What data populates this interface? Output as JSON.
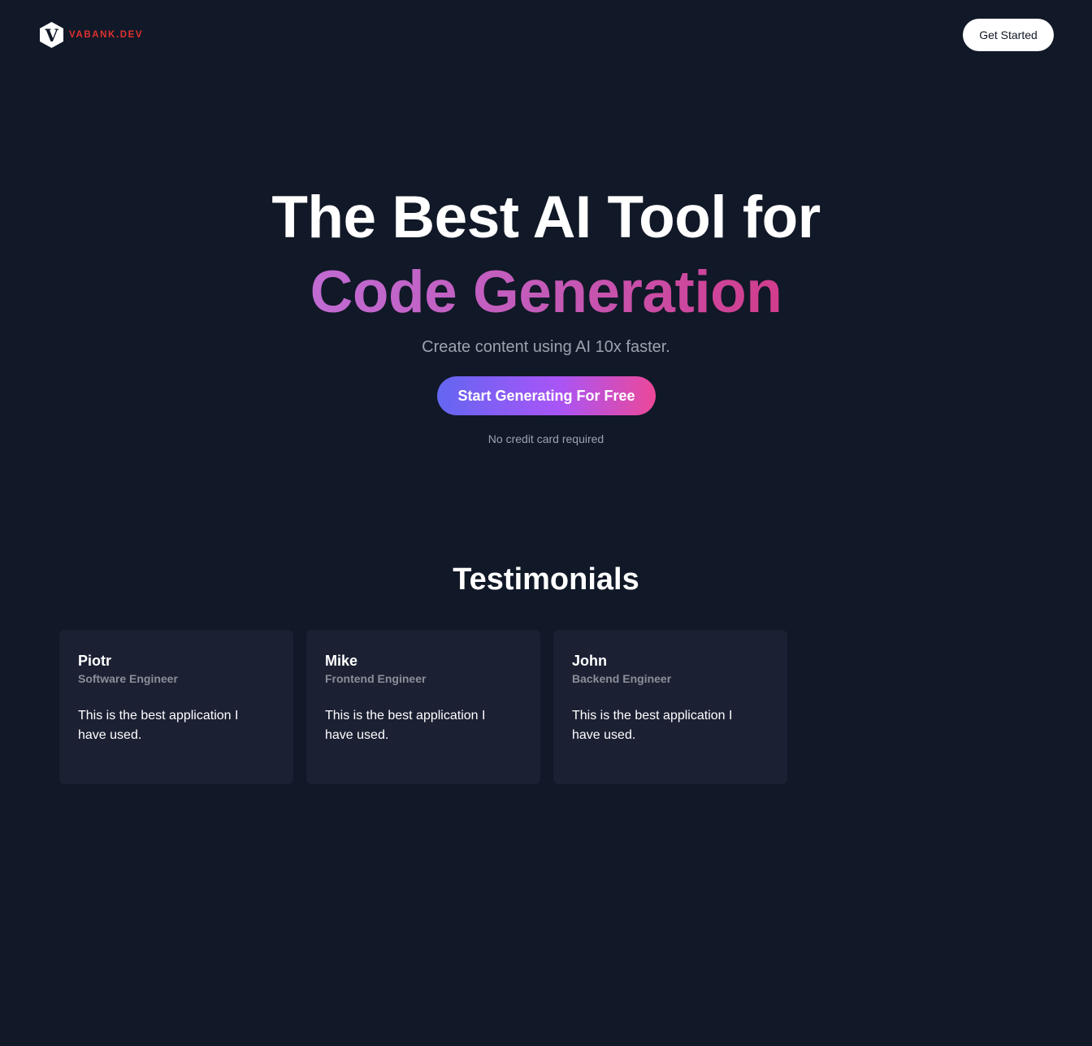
{
  "header": {
    "logo_letter": "V",
    "logo_text": "VABANK.DEV",
    "cta_label": "Get Started"
  },
  "hero": {
    "title_line1": "The Best AI Tool for",
    "title_line2": "Code Generation",
    "subtitle": "Create content using AI 10x faster.",
    "cta_label": "Start Generating For Free",
    "note": "No credit card required"
  },
  "testimonials": {
    "heading": "Testimonials",
    "items": [
      {
        "name": "Piotr",
        "role": "Software Engineer",
        "quote": "This is the best application I have used."
      },
      {
        "name": "Mike",
        "role": "Frontend Engineer",
        "quote": "This is the best application I have used."
      },
      {
        "name": "John",
        "role": "Backend Engineer",
        "quote": "This is the best application I have used."
      }
    ]
  },
  "colors": {
    "background": "#111827",
    "card": "#1b2033",
    "brand_red": "#e0312f",
    "gradient_start": "#6366f1",
    "gradient_end": "#ec4899"
  },
  "icons": {
    "logo": "hexagon-v-logo-icon"
  }
}
